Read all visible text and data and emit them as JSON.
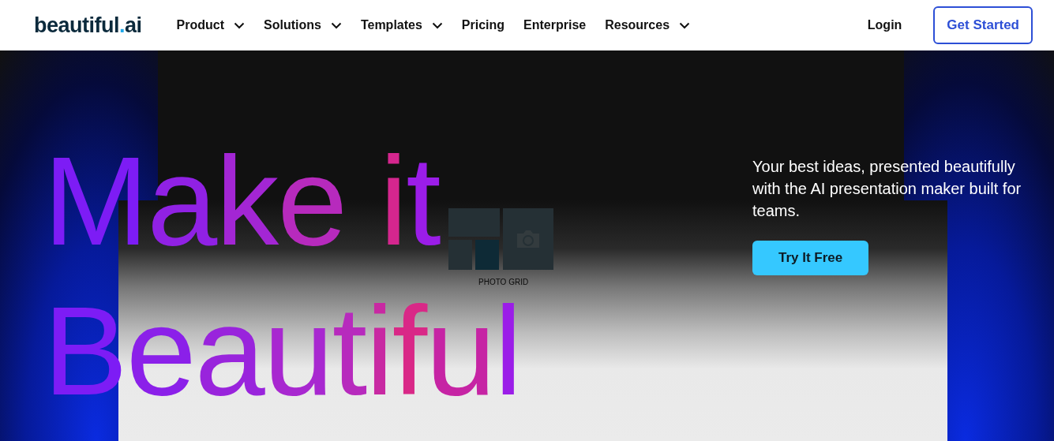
{
  "header": {
    "logo": {
      "name": "beautiful",
      "dot": ".",
      "suffix": "ai"
    },
    "nav": [
      {
        "label": "Product",
        "has_dropdown": true
      },
      {
        "label": "Solutions",
        "has_dropdown": true
      },
      {
        "label": "Templates",
        "has_dropdown": true
      },
      {
        "label": "Pricing",
        "has_dropdown": false
      },
      {
        "label": "Enterprise",
        "has_dropdown": false
      },
      {
        "label": "Resources",
        "has_dropdown": true
      }
    ],
    "login": "Login",
    "cta": "Get Started"
  },
  "hero": {
    "headline": [
      "Make it",
      "Beautiful"
    ],
    "subheading": "Your best ideas, presented beautifully with the AI presentation maker built for teams.",
    "cta": "Try It Free",
    "slide_preview": {
      "label": "PHOTO GRID"
    }
  }
}
